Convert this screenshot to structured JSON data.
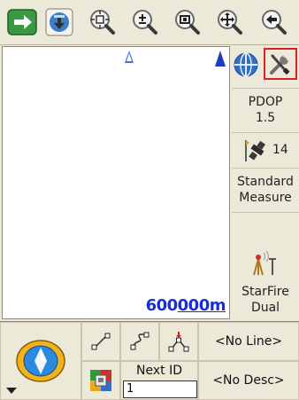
{
  "toolbar": {
    "buttons": [
      {
        "name": "next-arrow-icon",
        "color": "#2e8b3a"
      },
      {
        "name": "gps-download-icon",
        "color": "#3b7ec8"
      },
      {
        "name": "zoom-extent-icon",
        "color": "#808080"
      },
      {
        "name": "zoom-in-out-icon",
        "color": "#808080"
      },
      {
        "name": "zoom-window-icon",
        "color": "#808080"
      },
      {
        "name": "pan-icon",
        "color": "#808080"
      },
      {
        "name": "back-arrow-icon",
        "color": "#808080"
      }
    ]
  },
  "map": {
    "scale_prefix": "600",
    "scale_underlined": "000m"
  },
  "right_panel": {
    "pdop_label": "PDOP",
    "pdop_value": "1.5",
    "satellite_count": "14",
    "mode_line1": "Standard",
    "mode_line2": "Measure",
    "correction_line1": "StarFire",
    "correction_line2": "Dual"
  },
  "bottom": {
    "line_select": "<No Line>",
    "desc_select": "<No Desc>",
    "next_id_label": "Next ID",
    "next_id_value": "1"
  },
  "colors": {
    "accent_blue": "#1b2fd0",
    "highlight": "#e02020",
    "panel_bg": "#ece9d8"
  }
}
